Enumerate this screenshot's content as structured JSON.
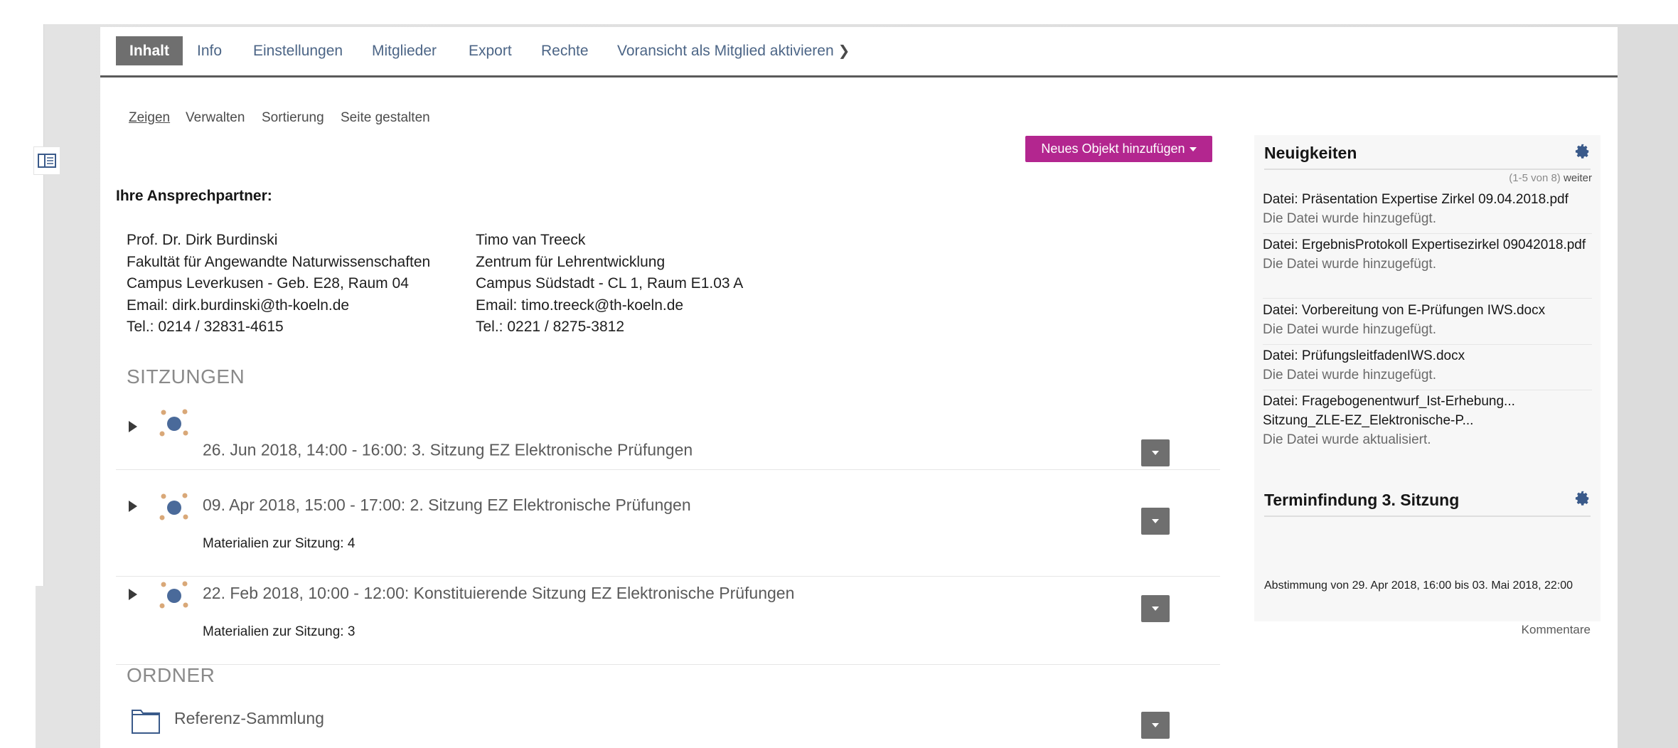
{
  "tabs": [
    {
      "label": "Inhalt",
      "active": true
    },
    {
      "label": "Info"
    },
    {
      "label": "Einstellungen"
    },
    {
      "label": "Mitglieder"
    },
    {
      "label": "Export"
    },
    {
      "label": "Rechte"
    },
    {
      "label": "Voransicht als Mitglied aktivieren"
    }
  ],
  "subtabs": [
    {
      "label": "Zeigen",
      "active": true
    },
    {
      "label": "Verwalten"
    },
    {
      "label": "Sortierung"
    },
    {
      "label": "Seite gestalten"
    }
  ],
  "new_object_button": "Neues Objekt hinzufügen",
  "contacts": {
    "title": "Ihre Ansprechpartner:",
    "people": [
      {
        "name": "Prof. Dr. Dirk Burdinski",
        "unit": "Fakultät für Angewandte Naturwissenschaften",
        "location": "Campus Leverkusen - Geb. E28, Raum 04",
        "email": "Email: dirk.burdinski@th-koeln.de",
        "phone": "Tel.: 0214 / 32831-4615"
      },
      {
        "name": "Timo van Treeck",
        "unit": "Zentrum für Lehrentwicklung",
        "location": "Campus Südstadt - CL 1, Raum E1.03 A",
        "email": "Email: timo.treeck@th-koeln.de",
        "phone": "Tel.: 0221 / 8275-3812"
      }
    ]
  },
  "sessions": {
    "heading": "SITZUNGEN",
    "items": [
      {
        "title": "26. Jun 2018, 14:00 - 16:00: 3. Sitzung EZ Elektronische Prüfungen",
        "sub": ""
      },
      {
        "title": "09. Apr 2018, 15:00 - 17:00: 2. Sitzung EZ Elektronische Prüfungen",
        "sub": "Materialien zur Sitzung: 4"
      },
      {
        "title": "22. Feb 2018, 10:00 - 12:00: Konstituierende Sitzung EZ Elektronische Prüfungen",
        "sub": "Materialien zur Sitzung: 3"
      }
    ]
  },
  "folders": {
    "heading": "ORDNER",
    "items": [
      {
        "title": "Referenz-Sammlung"
      }
    ]
  },
  "news": {
    "title": "Neuigkeiten",
    "count": "(1-5 von 8)",
    "more": "weiter",
    "items": [
      {
        "title": "Datei: Präsentation Expertise Zirkel 09.04.2018.pdf",
        "desc": "Die Datei wurde hinzugefügt."
      },
      {
        "title": "Datei: ErgebnisProtokoll Expertisezirkel 09042018.pdf",
        "desc": "Die Datei wurde hinzugefügt."
      },
      {
        "title": "Datei: Vorbereitung von E-Prüfungen IWS.docx",
        "desc": "Die Datei wurde hinzugefügt."
      },
      {
        "title": "Datei: PrüfungsleitfadenIWS.docx",
        "desc": "Die Datei wurde hinzugefügt."
      },
      {
        "title": "Datei: Fragebogenentwurf_Ist-Erhebung... Sitzung_ZLE-EZ_Elektronische-P...",
        "desc": "Die Datei wurde aktualisiert."
      }
    ]
  },
  "poll": {
    "title": "Terminfindung 3. Sitzung",
    "text": "Abstimmung von 29. Apr 2018, 16:00 bis 03. Mai 2018, 22:00",
    "comments": "Kommentare"
  },
  "colors": {
    "accent": "#b3268f",
    "tab_active": "#6f6f6f",
    "session_icon_blue": "#4a6a9a",
    "session_icon_dots": "#d9a878"
  }
}
